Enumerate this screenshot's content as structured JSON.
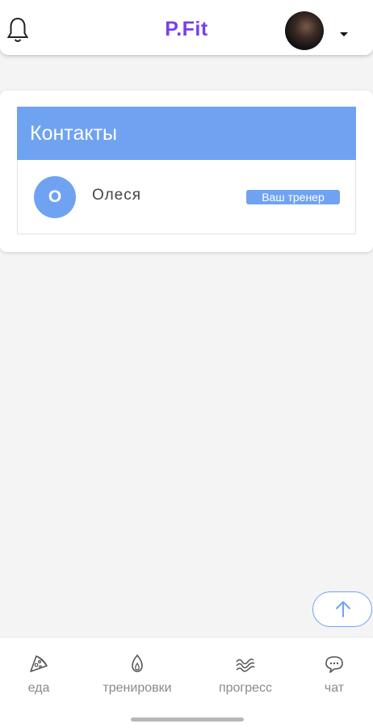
{
  "header": {
    "brand": "P.Fit",
    "icons": {
      "notifications": "bell-icon",
      "profile_menu": "caret-down-icon"
    }
  },
  "contacts": {
    "title": "Контакты",
    "items": [
      {
        "initial": "О",
        "name": "Олеся",
        "badge": "Ваш тренер"
      }
    ]
  },
  "scroll_up": {
    "icon": "arrow-up-icon"
  },
  "bottom_nav": {
    "items": [
      {
        "label": "еда",
        "icon": "pizza-icon"
      },
      {
        "label": "тренировки",
        "icon": "flame-icon"
      },
      {
        "label": "прогресс",
        "icon": "progress-wave-icon"
      },
      {
        "label": "чат",
        "icon": "chat-bubble-icon"
      }
    ]
  },
  "colors": {
    "accent_blue": "#6fa3f2",
    "brand_purple": "#7b3fe4",
    "background": "#f4f4f5"
  }
}
